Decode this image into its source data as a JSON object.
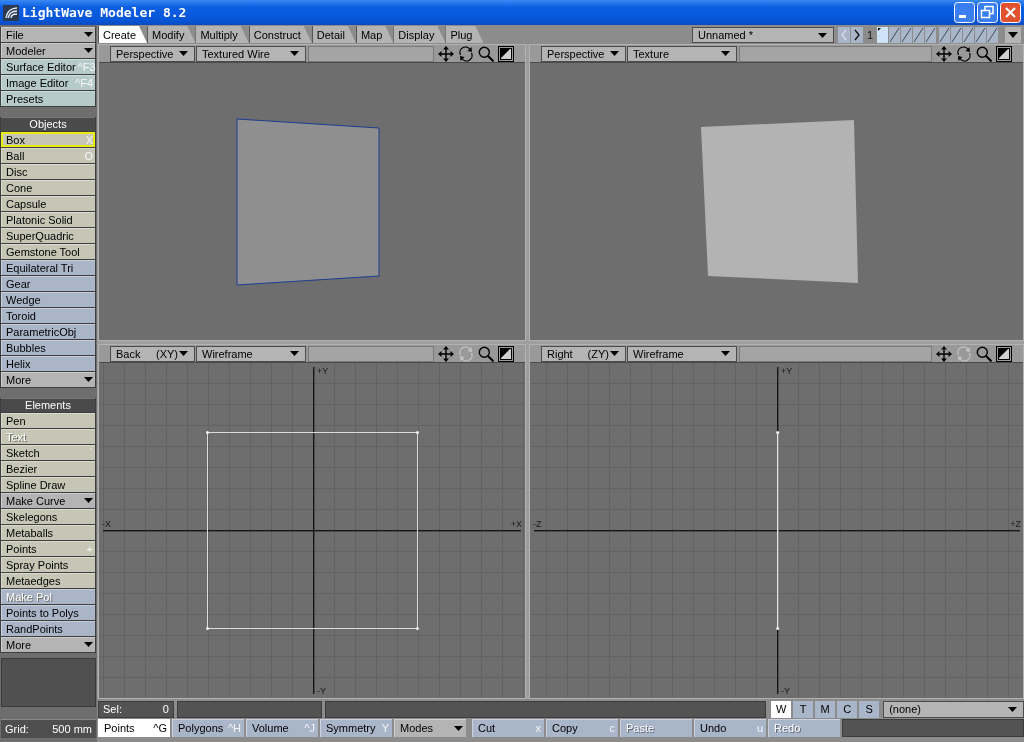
{
  "window": {
    "title": "LightWave Modeler 8.2",
    "controls": [
      {
        "kind": "minimize"
      },
      {
        "kind": "restore"
      },
      {
        "kind": "close"
      }
    ]
  },
  "sidebar": {
    "top_items": [
      {
        "label": "File",
        "kind": "dropdown",
        "color": "#b4b4b4"
      },
      {
        "label": "Modeler",
        "kind": "dropdown",
        "color": "#b4b4b4"
      },
      {
        "label": "Surface Editor",
        "shortcut": "^F3",
        "kind": "button",
        "color": "#b6caca"
      },
      {
        "label": "Image Editor",
        "shortcut": "^F4",
        "kind": "button",
        "color": "#b6caca"
      },
      {
        "label": "Presets",
        "kind": "button",
        "color": "#b6caca"
      }
    ],
    "groups": [
      {
        "title": "Objects",
        "items": [
          {
            "label": "Box",
            "shortcut": "X",
            "kind": "button",
            "color": "#c6c6b6",
            "selected": true,
            "disabled": false
          },
          {
            "label": "Ball",
            "shortcut": "O",
            "kind": "button",
            "color": "#c6c6b6",
            "selected": false,
            "disabled": false
          },
          {
            "label": "Disc",
            "kind": "button",
            "color": "#c6c6b6",
            "selected": false,
            "disabled": false
          },
          {
            "label": "Cone",
            "kind": "button",
            "color": "#c6c6b6",
            "selected": false,
            "disabled": false
          },
          {
            "label": "Capsule",
            "kind": "button",
            "color": "#c6c6b6",
            "selected": false,
            "disabled": false
          },
          {
            "label": "Platonic Solid",
            "kind": "button",
            "color": "#c6c6b6",
            "selected": false,
            "disabled": false
          },
          {
            "label": "SuperQuadric",
            "kind": "button",
            "color": "#c6c6b6",
            "selected": false,
            "disabled": false
          },
          {
            "label": "Gemstone Tool",
            "kind": "button",
            "color": "#c6c6b6",
            "selected": false,
            "disabled": false
          },
          {
            "label": "Equilateral Tri",
            "kind": "button",
            "color": "#aab6c8",
            "selected": false,
            "disabled": false
          },
          {
            "label": "Gear",
            "kind": "button",
            "color": "#aab6c8",
            "selected": false,
            "disabled": false
          },
          {
            "label": "Wedge",
            "kind": "button",
            "color": "#aab6c8",
            "selected": false,
            "disabled": false
          },
          {
            "label": "Toroid",
            "kind": "button",
            "color": "#aab6c8",
            "selected": false,
            "disabled": false
          },
          {
            "label": "ParametricObj",
            "kind": "button",
            "color": "#aab6c8",
            "selected": false,
            "disabled": false
          },
          {
            "label": "Bubbles",
            "kind": "button",
            "color": "#aab6c8",
            "selected": false,
            "disabled": false
          },
          {
            "label": "Helix",
            "kind": "button",
            "color": "#aab6c8",
            "selected": false,
            "disabled": false
          },
          {
            "label": "More",
            "kind": "dropdown",
            "color": "#b4b4b4",
            "selected": false,
            "disabled": false
          }
        ]
      },
      {
        "title": "Elements",
        "items": [
          {
            "label": "Pen",
            "kind": "button",
            "color": "#c6c6b6",
            "selected": false,
            "disabled": false
          },
          {
            "label": "Text",
            "kind": "button",
            "color": "#c6c6b6",
            "selected": false,
            "disabled": true
          },
          {
            "label": "Sketch",
            "shortcut": "`",
            "kind": "button",
            "color": "#c6c6b6",
            "selected": false,
            "disabled": false
          },
          {
            "label": "Bezier",
            "kind": "button",
            "color": "#c6c6b6",
            "selected": false,
            "disabled": false
          },
          {
            "label": "Spline Draw",
            "kind": "button",
            "color": "#c6c6b6",
            "selected": false,
            "disabled": false
          },
          {
            "label": "Make Curve",
            "kind": "dropdown",
            "color": "#b4b4b4",
            "selected": false,
            "disabled": false
          },
          {
            "label": "Skelegons",
            "kind": "button",
            "color": "#c6c6b6",
            "selected": false,
            "disabled": false
          },
          {
            "label": "Metaballs",
            "kind": "button",
            "color": "#c6c6b6",
            "selected": false,
            "disabled": false
          },
          {
            "label": "Points",
            "shortcut": "+",
            "kind": "button",
            "color": "#c6c6b6",
            "selected": false,
            "disabled": false
          },
          {
            "label": "Spray Points",
            "kind": "button",
            "color": "#c6c6b6",
            "selected": false,
            "disabled": false
          },
          {
            "label": "Metaedges",
            "kind": "button",
            "color": "#c6c6b6",
            "selected": false,
            "disabled": false
          },
          {
            "label": "Make Pol",
            "kind": "button",
            "color": "#aab6c8",
            "selected": false,
            "disabled": true
          },
          {
            "label": "Points to Polys",
            "kind": "button",
            "color": "#aab6c8",
            "selected": false,
            "disabled": false
          },
          {
            "label": "RandPoints",
            "kind": "button",
            "color": "#aab6c8",
            "selected": false,
            "disabled": false
          },
          {
            "label": "More",
            "kind": "dropdown",
            "color": "#b4b4b4",
            "selected": false,
            "disabled": false
          }
        ]
      }
    ],
    "grid": {
      "label": "Grid:",
      "value": "500 mm"
    }
  },
  "tabs": [
    {
      "label": "Create",
      "selected": true
    },
    {
      "label": "Modify",
      "selected": false
    },
    {
      "label": "Multiply",
      "selected": false
    },
    {
      "label": "Construct",
      "selected": false
    },
    {
      "label": "Detail",
      "selected": false
    },
    {
      "label": "Map",
      "selected": false
    },
    {
      "label": "Display",
      "selected": false
    },
    {
      "label": "Plug",
      "selected": false
    }
  ],
  "object_menu": {
    "value": "Unnamed *"
  },
  "layer_nav": [
    {
      "kind": "prev",
      "disabled": true
    },
    {
      "kind": "next",
      "disabled": false
    }
  ],
  "layer_number": "1",
  "layers": [
    {
      "selected": true
    },
    {
      "selected": false
    },
    {
      "selected": false
    },
    {
      "selected": false
    },
    {
      "selected": false
    },
    {
      "selected": false
    },
    {
      "selected": false
    },
    {
      "selected": false
    },
    {
      "selected": false
    },
    {
      "selected": false
    }
  ],
  "viewports": [
    {
      "view": "Perspective",
      "mode": "Textured Wire",
      "kind": "shaded-wire",
      "tools": [
        {
          "kind": "move",
          "disabled": false
        },
        {
          "kind": "rotate",
          "disabled": false
        },
        {
          "kind": "zoom",
          "disabled": false
        },
        {
          "kind": "maximize",
          "disabled": false
        }
      ]
    },
    {
      "view": "Perspective",
      "mode": "Texture",
      "kind": "shaded",
      "tools": [
        {
          "kind": "move",
          "disabled": false
        },
        {
          "kind": "rotate",
          "disabled": false
        },
        {
          "kind": "zoom",
          "disabled": false
        },
        {
          "kind": "maximize",
          "disabled": false
        }
      ]
    },
    {
      "view": "Back",
      "axes": "(XY)",
      "mode": "Wireframe",
      "kind": "grid-square",
      "tools": [
        {
          "kind": "move",
          "disabled": false
        },
        {
          "kind": "rotate",
          "disabled": true
        },
        {
          "kind": "zoom",
          "disabled": false
        },
        {
          "kind": "maximize",
          "disabled": false
        }
      ],
      "axis_labels": [
        {
          "kind": "top",
          "text": "+Y"
        },
        {
          "kind": "left",
          "text": "-X"
        },
        {
          "kind": "right",
          "text": "+X"
        },
        {
          "kind": "bottom",
          "text": "-Y"
        }
      ]
    },
    {
      "view": "Right",
      "axes": "(ZY)",
      "mode": "Wireframe",
      "kind": "grid-edge",
      "tools": [
        {
          "kind": "move",
          "disabled": false
        },
        {
          "kind": "rotate",
          "disabled": true
        },
        {
          "kind": "zoom",
          "disabled": false
        },
        {
          "kind": "maximize",
          "disabled": false
        }
      ],
      "axis_labels": [
        {
          "kind": "top",
          "text": "+Y"
        },
        {
          "kind": "left",
          "text": "-Z"
        },
        {
          "kind": "right",
          "text": "+Z"
        },
        {
          "kind": "bottom",
          "text": "-Y"
        }
      ]
    }
  ],
  "status": {
    "sel_label": "Sel:",
    "sel_value": "0",
    "view_modes": [
      {
        "label": "W",
        "selected": true
      },
      {
        "label": "T",
        "selected": false
      },
      {
        "label": "M",
        "selected": false
      },
      {
        "label": "C",
        "selected": false
      },
      {
        "label": "S",
        "selected": false
      }
    ],
    "surface": "(none)"
  },
  "selection_tools": [
    {
      "label": "Points",
      "shortcut": "^G",
      "kind": "button",
      "selected": true
    },
    {
      "label": "Polygons",
      "shortcut": "^H",
      "kind": "button",
      "selected": false
    },
    {
      "label": "Volume",
      "shortcut": "^J",
      "kind": "button",
      "selected": false
    },
    {
      "label": "Symmetry",
      "shortcut": "Y",
      "kind": "button",
      "selected": false
    },
    {
      "label": "Modes",
      "kind": "dropdown",
      "selected": false
    }
  ],
  "edit_tools": [
    {
      "label": "Cut",
      "shortcut": "x",
      "disabled": false
    },
    {
      "label": "Copy",
      "shortcut": "c",
      "disabled": false
    },
    {
      "label": "Paste",
      "disabled": true
    },
    {
      "label": "Undo",
      "shortcut": "u",
      "disabled": false
    },
    {
      "label": "Redo",
      "disabled": true
    }
  ]
}
